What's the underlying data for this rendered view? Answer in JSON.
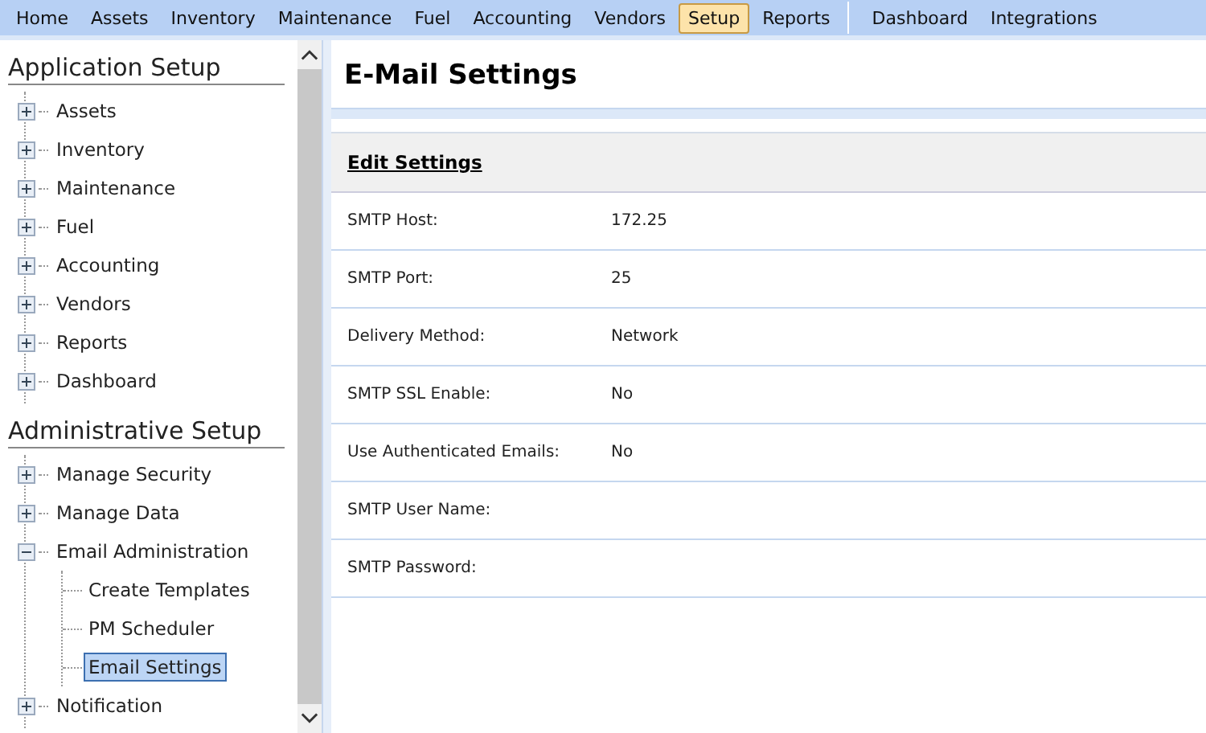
{
  "menu": [
    {
      "label": "Home",
      "selected": false
    },
    {
      "label": "Assets",
      "selected": false
    },
    {
      "label": "Inventory",
      "selected": false
    },
    {
      "label": "Maintenance",
      "selected": false
    },
    {
      "label": "Fuel",
      "selected": false
    },
    {
      "label": "Accounting",
      "selected": false
    },
    {
      "label": "Vendors",
      "selected": false
    },
    {
      "label": "Setup",
      "selected": true
    },
    {
      "label": "Reports",
      "selected": false
    },
    {
      "label": "Dashboard",
      "selected": false,
      "separator_before": true
    },
    {
      "label": "Integrations",
      "selected": false
    }
  ],
  "sidebar": {
    "sections": [
      {
        "title": "Application Setup",
        "items": [
          {
            "label": "Assets",
            "expanded": false,
            "selected": false
          },
          {
            "label": "Inventory",
            "expanded": false,
            "selected": false
          },
          {
            "label": "Maintenance",
            "expanded": false,
            "selected": false
          },
          {
            "label": "Fuel",
            "expanded": false,
            "selected": false
          },
          {
            "label": "Accounting",
            "expanded": false,
            "selected": false
          },
          {
            "label": "Vendors",
            "expanded": false,
            "selected": false
          },
          {
            "label": "Reports",
            "expanded": false,
            "selected": false
          },
          {
            "label": "Dashboard",
            "expanded": false,
            "selected": false
          }
        ]
      },
      {
        "title": "Administrative Setup",
        "items": [
          {
            "label": "Manage Security",
            "expanded": false,
            "selected": false
          },
          {
            "label": "Manage Data",
            "expanded": false,
            "selected": false
          },
          {
            "label": "Email Administration",
            "expanded": true,
            "selected": false,
            "children": [
              {
                "label": "Create Templates",
                "selected": false
              },
              {
                "label": "PM Scheduler",
                "selected": false
              },
              {
                "label": "Email Settings",
                "selected": true
              }
            ]
          },
          {
            "label": "Notification",
            "expanded": false,
            "selected": false
          }
        ]
      }
    ]
  },
  "page": {
    "title": "E-Mail Settings",
    "section": "Edit Settings",
    "fields": [
      {
        "label": "SMTP Host:",
        "value": "172.25"
      },
      {
        "label": "SMTP Port:",
        "value": "25"
      },
      {
        "label": "Delivery Method:",
        "value": "Network"
      },
      {
        "label": "SMTP SSL Enable:",
        "value": "No"
      },
      {
        "label": "Use Authenticated Emails:",
        "value": "No"
      },
      {
        "label": "SMTP User Name:"
      },
      {
        "label": "SMTP Password:"
      }
    ]
  }
}
